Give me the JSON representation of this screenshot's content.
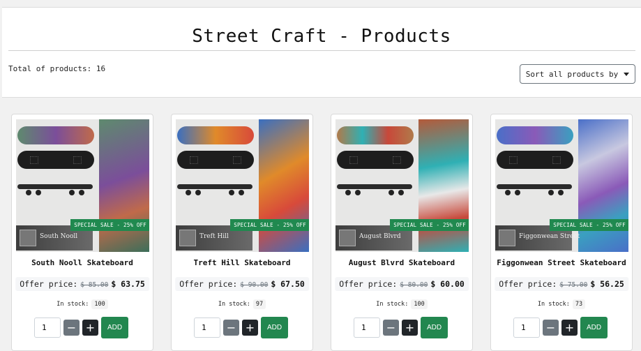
{
  "header": {
    "title": "Street Craft - Products",
    "total_label": "Total of products: 16",
    "sort_label": "Sort all products by"
  },
  "products": [
    {
      "name": "South Nooll Skateboard",
      "badge_text": "South Nooll",
      "sale_label": "SPECIAL SALE - 25% OFF",
      "offer_label": "Offer price:",
      "old_price": "$ 85.00",
      "new_price": "$ 63.75",
      "stock_label": "In stock:",
      "stock": "100",
      "qty": "1",
      "add_label": "ADD",
      "board_colors": [
        "#5e8a6e",
        "#7b4e9a",
        "#c06a4a"
      ]
    },
    {
      "name": "Treft Hill Skateboard",
      "badge_text": "Treft Hill",
      "sale_label": "SPECIAL SALE - 25% OFF",
      "offer_label": "Offer price:",
      "old_price": "$ 90.00",
      "new_price": "$ 67.50",
      "stock_label": "In stock:",
      "stock": "97",
      "qty": "1",
      "add_label": "ADD",
      "board_colors": [
        "#e08a2a",
        "#3a6fc0",
        "#d84a3a"
      ]
    },
    {
      "name": "August Blvrd Skateboard",
      "badge_text": "August Blvrd",
      "sale_label": "SPECIAL SALE - 25% OFF",
      "offer_label": "Offer price:",
      "old_price": "$ 80.00",
      "new_price": "$ 60.00",
      "stock_label": "In stock:",
      "stock": "100",
      "qty": "1",
      "add_label": "ADD",
      "board_colors": [
        "#2fb0b4",
        "#c8483a",
        "#2a2a2a"
      ]
    },
    {
      "name": "Figgonwean Street Skateboard",
      "badge_text": "Figgonwean Street",
      "sale_label": "SPECIAL SALE - 25% OFF",
      "offer_label": "Offer price:",
      "old_price": "$ 75.00",
      "new_price": "$ 56.25",
      "stock_label": "In stock:",
      "stock": "73",
      "qty": "1",
      "add_label": "ADD",
      "board_colors": [
        "#4a6fc8",
        "#8a5ab8",
        "#3aa0c0"
      ]
    }
  ]
}
